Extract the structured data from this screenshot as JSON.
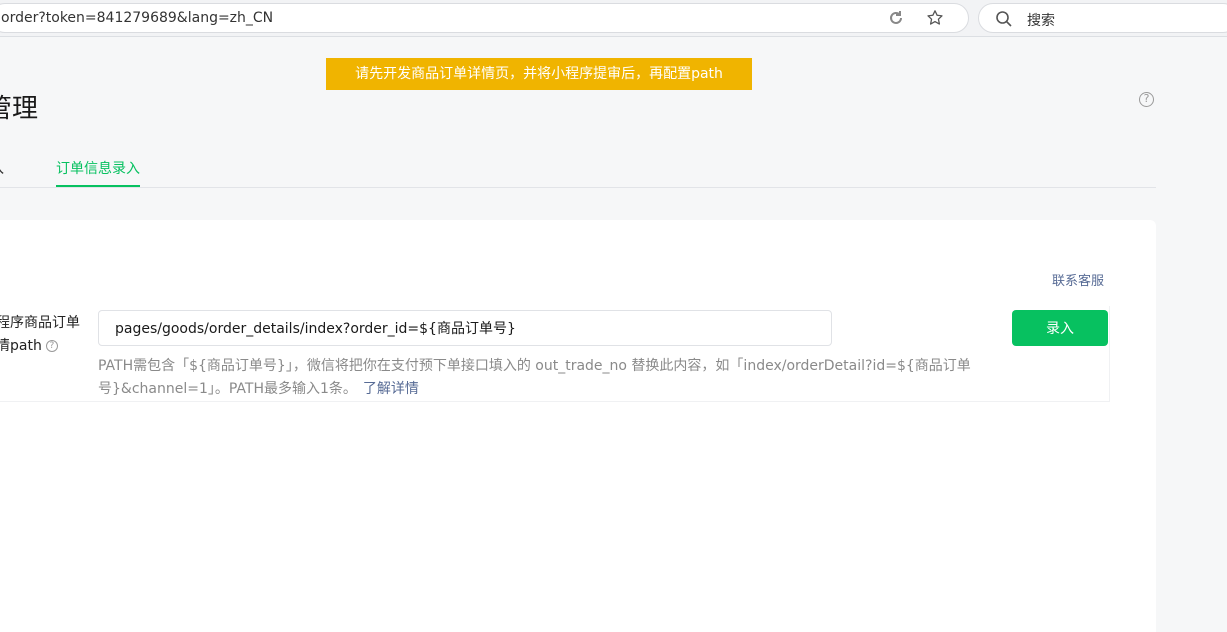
{
  "browser": {
    "url": "order?token=841279689&lang=zh_CN",
    "search_placeholder": "搜索"
  },
  "notice": {
    "text": "请先开发商品订单详情页，并将小程序提审后，再配置path"
  },
  "page": {
    "title": "管理",
    "help_glyph": "?"
  },
  "tabs": [
    {
      "label": "入",
      "active": false
    },
    {
      "label": "订单信息录入",
      "active": true
    }
  ],
  "card": {
    "contact_label": "联系客服",
    "field": {
      "label_line1": "程序商品订单",
      "label_line2": "情path",
      "help_glyph": "?",
      "value": "pages/goods/order_details/index?order_id=${商品订单号}",
      "submit_label": "录入",
      "hint_text": "PATH需包含「${商品订单号}」，微信将把你在支付预下单接口填入的 out_trade_no 替换此内容，如「index/orderDetail?id=${商品订单号}&channel=1」。PATH最多输入1条。",
      "learn_more_label": "了解详情"
    }
  },
  "colors": {
    "accent": "#07c160",
    "notice_bg": "#f0b400",
    "link": "#576b95"
  }
}
